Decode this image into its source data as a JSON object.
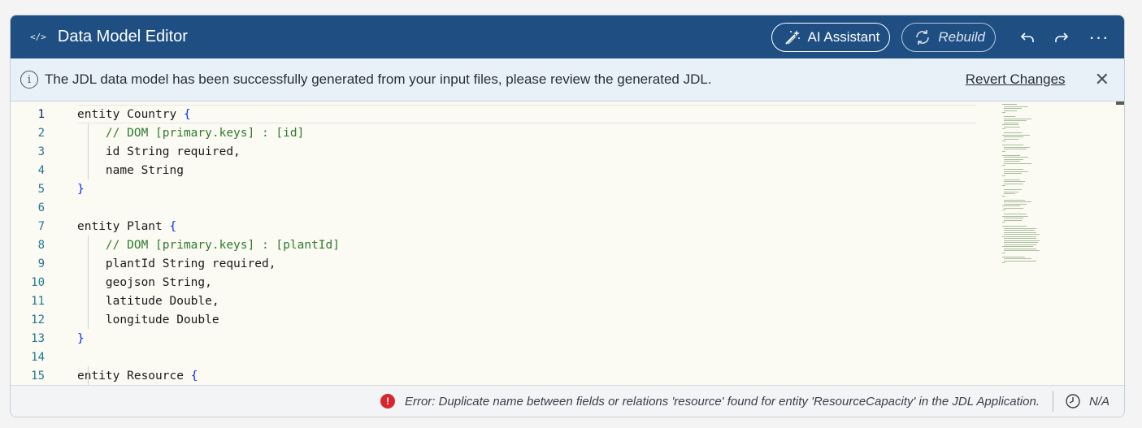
{
  "header": {
    "code_icon": "</>",
    "title": "Data Model Editor",
    "ai_assistant_label": "AI Assistant",
    "rebuild_label": "Rebuild",
    "more_label": "···"
  },
  "info": {
    "message": "The JDL data model has been successfully generated from your input files, please review the generated JDL.",
    "revert_label": "Revert Changes",
    "close_label": "✕"
  },
  "editor": {
    "lines": [
      {
        "n": "1",
        "text": "entity Country "
      },
      {
        "n": "2",
        "text": "    // DOM [primary.keys] : [id]"
      },
      {
        "n": "3",
        "text": "    id String required,"
      },
      {
        "n": "4",
        "text": "    name String"
      },
      {
        "n": "5",
        "text": "}"
      },
      {
        "n": "6",
        "text": ""
      },
      {
        "n": "7",
        "text": "entity Plant "
      },
      {
        "n": "8",
        "text": "    // DOM [primary.keys] : [plantId]"
      },
      {
        "n": "9",
        "text": "    plantId String required,"
      },
      {
        "n": "10",
        "text": "    geojson String,"
      },
      {
        "n": "11",
        "text": "    latitude Double,"
      },
      {
        "n": "12",
        "text": "    longitude Double"
      },
      {
        "n": "13",
        "text": "}"
      },
      {
        "n": "14",
        "text": ""
      },
      {
        "n": "15",
        "text": "entity Resource "
      }
    ]
  },
  "footer": {
    "error_message": "Error: Duplicate name between fields or relations 'resource' found for entity 'ResourceCapacity' in the JDL Application.",
    "status_value": "N/A"
  }
}
